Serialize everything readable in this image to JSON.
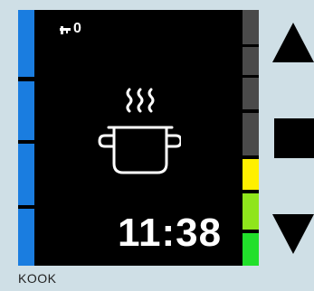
{
  "display": {
    "key_indicator": "0",
    "time": "11:38",
    "mode_icon": "cooking-pot-icon"
  },
  "buttons": {
    "up": "triangle-up-icon",
    "stop": "square-stop-icon",
    "down": "triangle-down-icon"
  },
  "caption": "KOOK",
  "colors": {
    "background": "#cfdfe6",
    "screen": "#000000",
    "blue_bar": "#1a7de0",
    "inactive_segment": "#4a4a4a",
    "level_yellow": "#fff000",
    "level_lightgreen": "#8fe51c",
    "level_green": "#21e02b"
  },
  "power_level": {
    "active_segments": 3,
    "total_segments": 7
  }
}
